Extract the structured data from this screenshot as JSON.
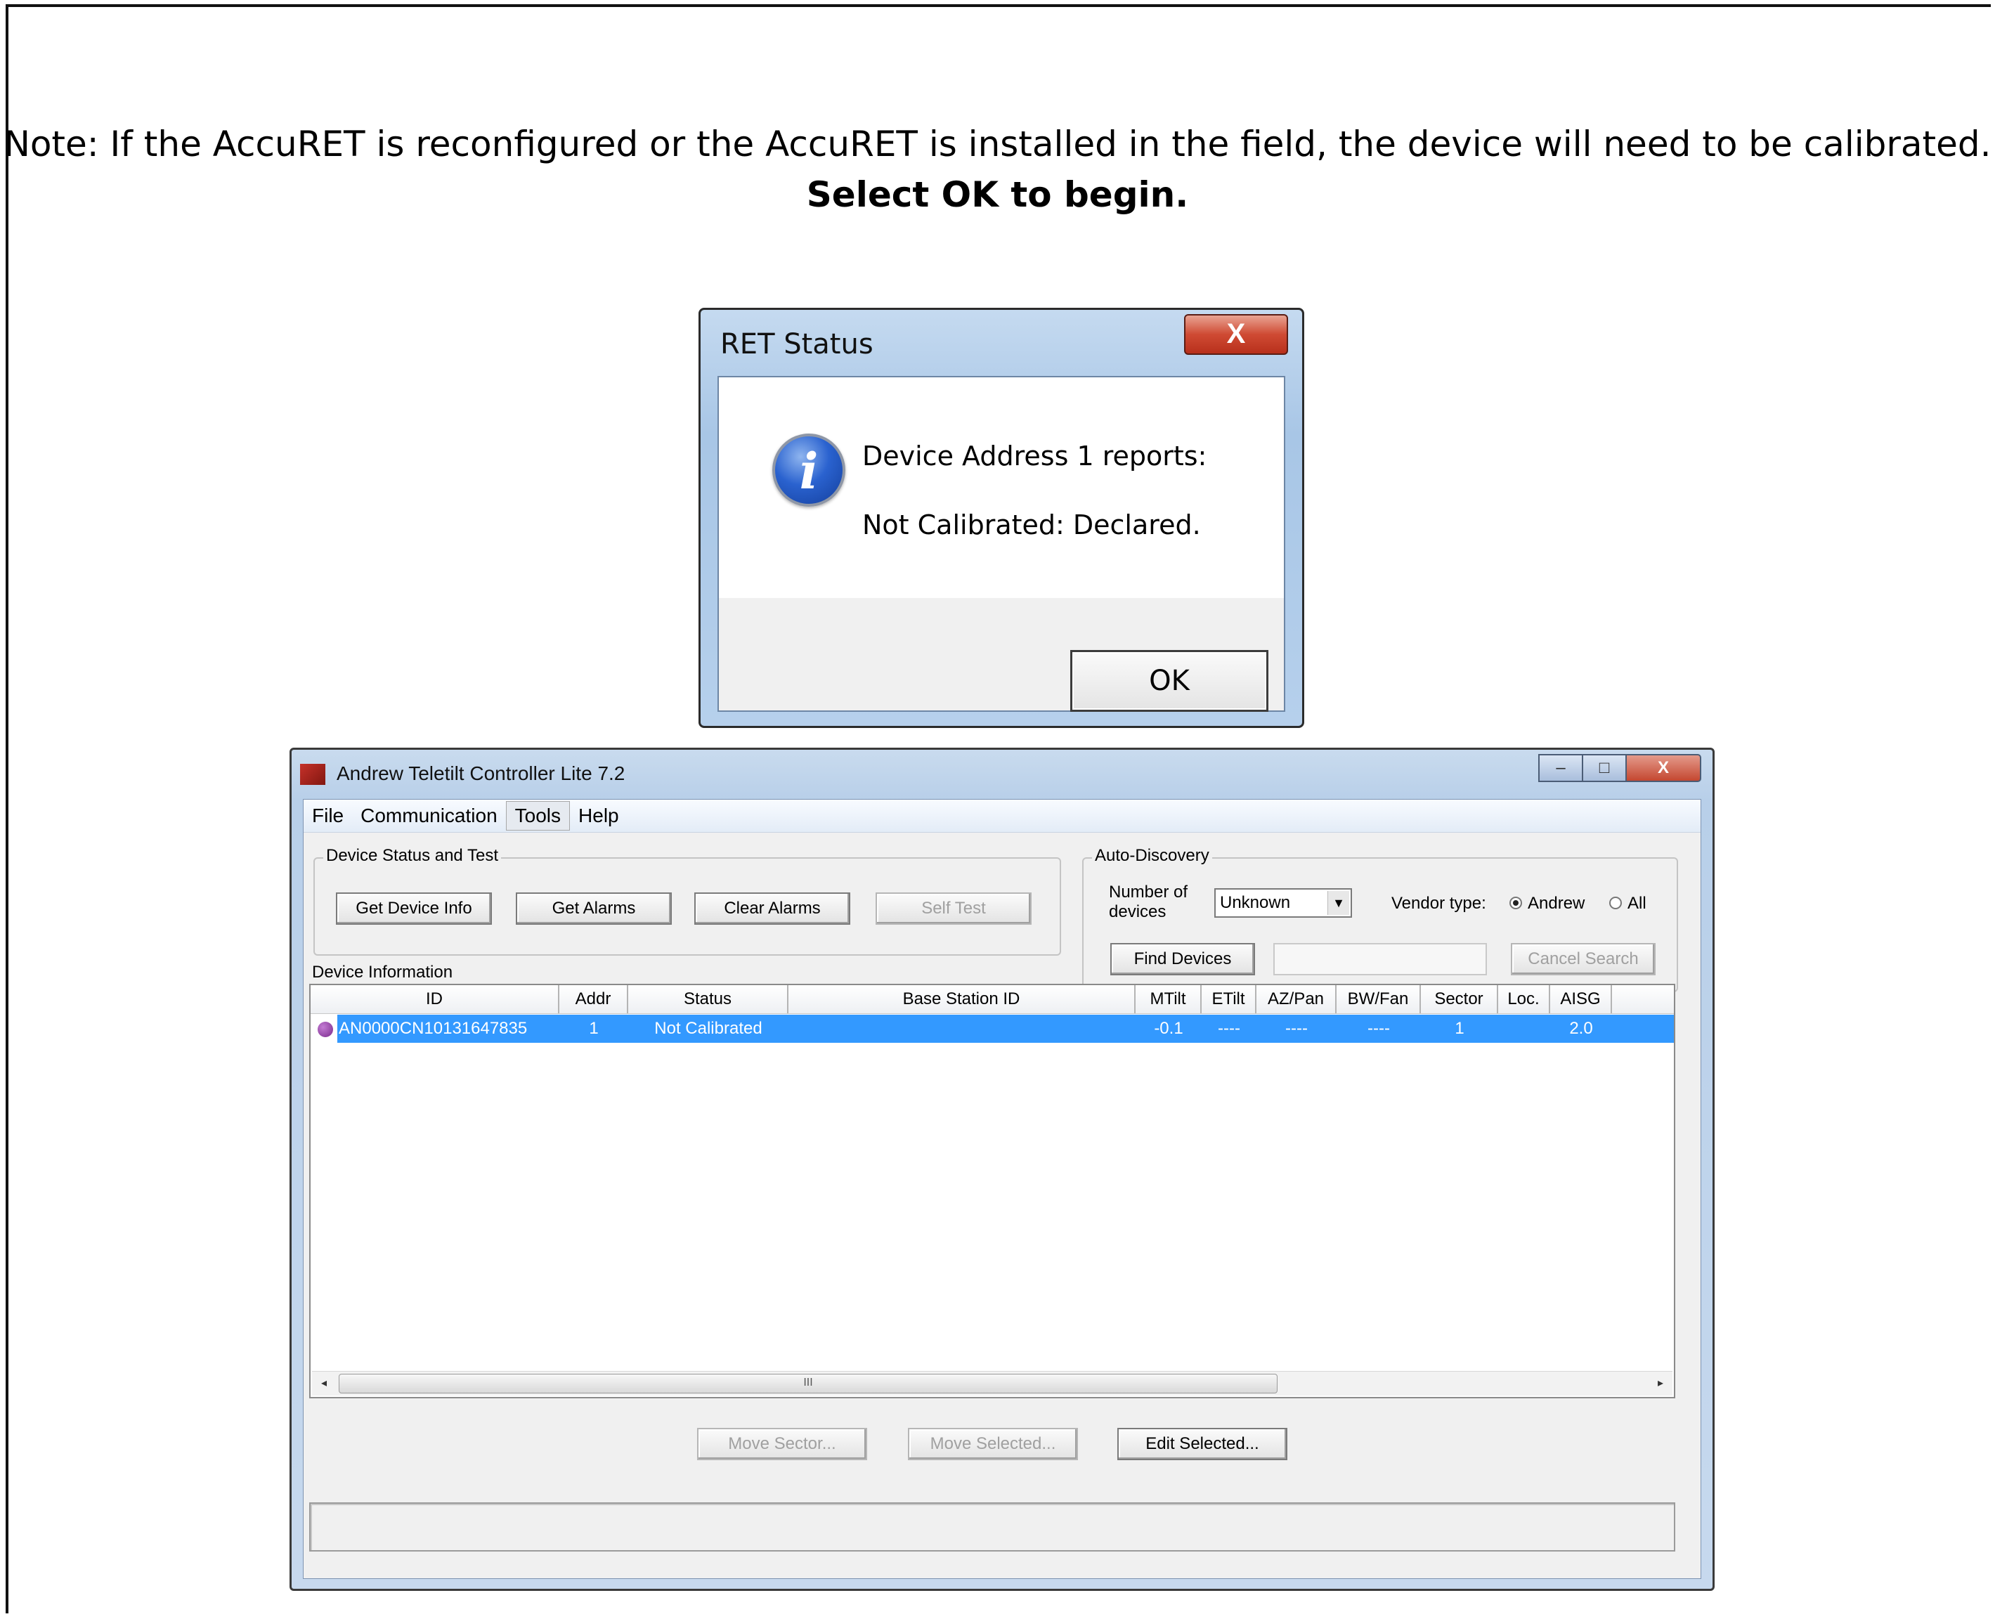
{
  "note": {
    "line1": "Note: If the AccuRET is reconfigured or the AccuRET is installed in the field, the device will need  to be calibrated.",
    "line2": "Select OK to begin."
  },
  "dialog": {
    "title": "RET Status",
    "close_glyph": "X",
    "icon": "information-icon",
    "icon_glyph": "i",
    "message_line1": "Device Address 1 reports:",
    "message_line2": "Not Calibrated:  Declared.",
    "ok_label": "OK"
  },
  "app": {
    "title": "Andrew Teletilt Controller Lite 7.2",
    "window_buttons": {
      "minimize": "‒",
      "maximize": "□",
      "close": "X"
    },
    "menu": [
      "File",
      "Communication",
      "Tools",
      "Help"
    ],
    "device_status_group": {
      "legend": "Device Status and Test",
      "buttons": [
        "Get Device Info",
        "Get Alarms",
        "Clear Alarms",
        "Self Test"
      ]
    },
    "auto_discovery": {
      "legend": "Auto-Discovery",
      "number_label_line1": "Number of",
      "number_label_line2": "devices",
      "number_value": "Unknown",
      "vendor_label": "Vendor type:",
      "vendor_options": [
        "Andrew",
        "All"
      ],
      "vendor_selected": "Andrew",
      "find_button": "Find Devices",
      "cancel_button": "Cancel Search"
    },
    "device_info_label": "Device Information",
    "table": {
      "columns": [
        "ID",
        "Addr",
        "Status",
        "Base Station ID",
        "MTilt",
        "ETilt",
        "AZ/Pan",
        "BW/Fan",
        "Sector",
        "Loc.",
        "AISG"
      ],
      "rows": [
        {
          "ID": "AN0000CN10131647835",
          "Addr": "1",
          "Status": "Not Calibrated",
          "Base Station ID": "",
          "MTilt": "-0.1",
          "ETilt": "----",
          "AZ/Pan": "----",
          "BW/Fan": "----",
          "Sector": "1",
          "Loc.": "--",
          "AISG": "2.0"
        }
      ],
      "scroll_thumb_glyph": "III"
    },
    "bottom_buttons": [
      "Move Sector...",
      "Move Selected...",
      "Edit Selected..."
    ]
  }
}
